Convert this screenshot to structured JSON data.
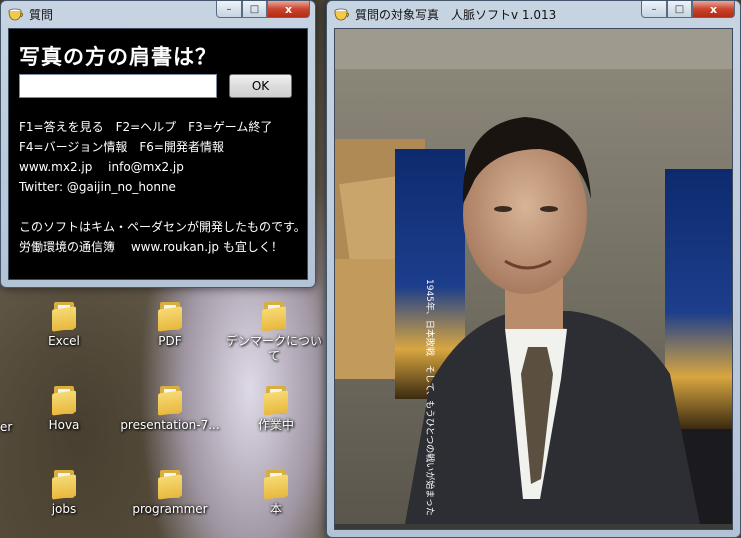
{
  "desktop": {
    "icons": [
      {
        "label": "Excel"
      },
      {
        "label": "PDF"
      },
      {
        "label": "デンマークについて"
      },
      {
        "label": "Hova"
      },
      {
        "label": "presentation-7..."
      },
      {
        "label": "作業中"
      },
      {
        "label": "jobs"
      },
      {
        "label": "programmer"
      },
      {
        "label": "本"
      },
      {
        "label": "er"
      }
    ]
  },
  "quiz_window": {
    "title": "質問",
    "question": "写真の方の肩書は？",
    "answer_value": "",
    "ok_label": "OK",
    "lines": [
      "F1=答えを見る　F2=ヘルプ　F3=ゲーム終了",
      "F4=バージョン情報　F6=開発者情報",
      "www.mx2.jp　 info@mx2.jp",
      "Twitter: @gaijin_no_honne",
      "",
      "このソフトはキム・ペーダセンが開発したものです。",
      "労働環境の通信簿　 www.roukan.jp も宜しく！"
    ]
  },
  "photo_window": {
    "title": "質問の対象写真　人脈ソフトv 1.013",
    "poster_text": "1945年、日本敗戦　そして、もうひとつの戦いが始まった"
  },
  "caption_buttons": {
    "minimize": "–",
    "maximize": "□",
    "close": "x"
  }
}
